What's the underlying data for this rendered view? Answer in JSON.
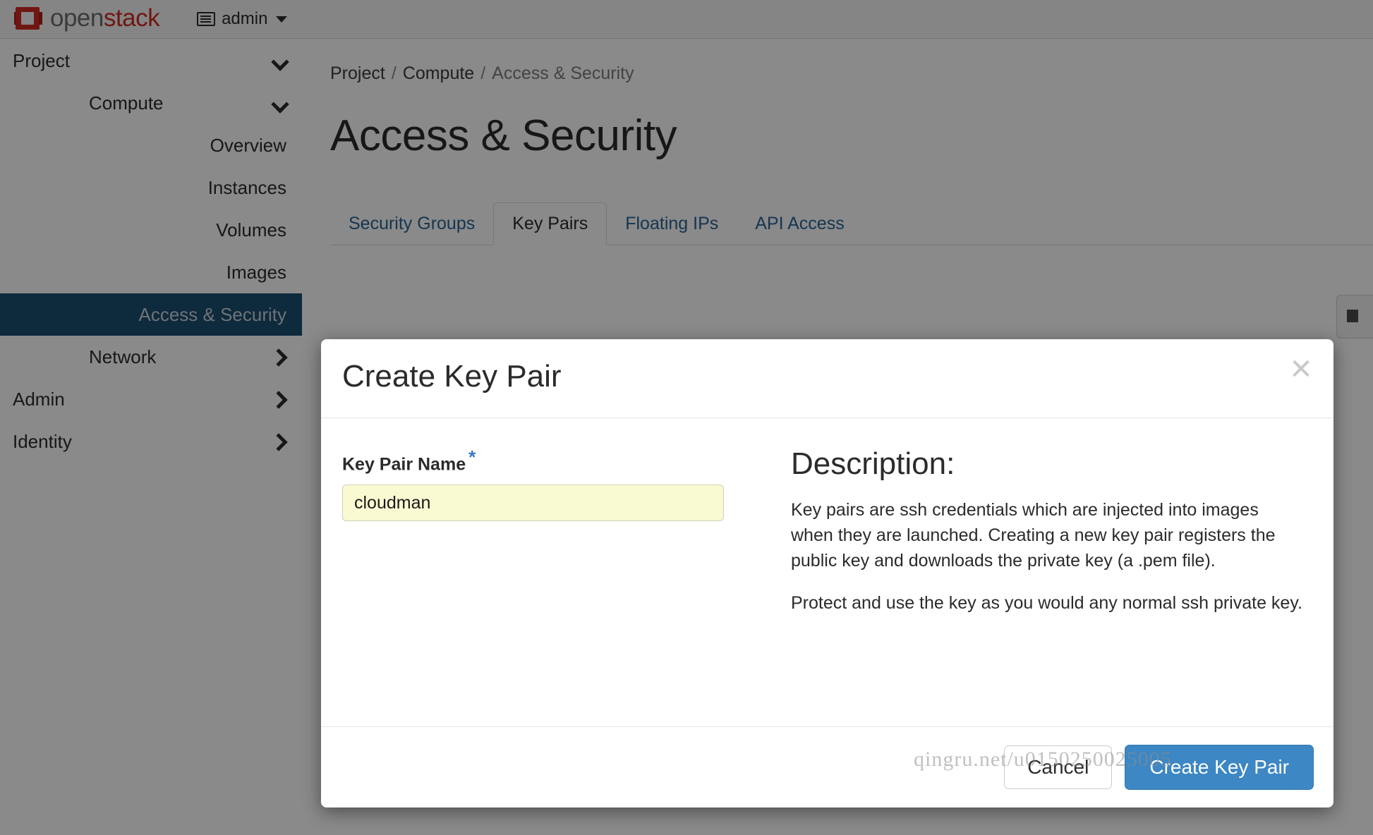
{
  "topbar": {
    "brand_open": "open",
    "brand_stack": "stack",
    "user_label": "admin",
    "list_icon": "list-icon",
    "caret_icon": "caret-down-icon"
  },
  "sidebar": {
    "items": [
      {
        "label": "Project",
        "level": 0,
        "chevron": "down",
        "active": false
      },
      {
        "label": "Compute",
        "level": 1,
        "chevron": "down",
        "active": false
      },
      {
        "label": "Overview",
        "level": 2,
        "chevron": "none",
        "active": false
      },
      {
        "label": "Instances",
        "level": 2,
        "chevron": "none",
        "active": false
      },
      {
        "label": "Volumes",
        "level": 2,
        "chevron": "none",
        "active": false
      },
      {
        "label": "Images",
        "level": 2,
        "chevron": "none",
        "active": false
      },
      {
        "label": "Access & Security",
        "level": 2,
        "chevron": "none",
        "active": true
      },
      {
        "label": "Network",
        "level": 1,
        "chevron": "right",
        "active": false
      },
      {
        "label": "Admin",
        "level": 0,
        "chevron": "right",
        "active": false
      },
      {
        "label": "Identity",
        "level": 0,
        "chevron": "right",
        "active": false
      }
    ]
  },
  "breadcrumb": {
    "items": [
      "Project",
      "Compute",
      "Access & Security"
    ],
    "separator": "/"
  },
  "page": {
    "title": "Access & Security"
  },
  "tabs": [
    {
      "label": "Security Groups",
      "active": false
    },
    {
      "label": "Key Pairs",
      "active": true
    },
    {
      "label": "Floating IPs",
      "active": false
    },
    {
      "label": "API Access",
      "active": false
    }
  ],
  "modal": {
    "title": "Create Key Pair",
    "close_icon": "close-icon",
    "form": {
      "field_label": "Key Pair Name",
      "required_marker": "*",
      "value": "cloudman",
      "placeholder": ""
    },
    "description": {
      "heading": "Description:",
      "paragraphs": [
        "Key pairs are ssh credentials which are injected into images when they are launched. Creating a new key pair registers the public key and downloads the private key (a .pem file).",
        "Protect and use the key as you would any normal ssh private key."
      ]
    },
    "footer": {
      "cancel_label": "Cancel",
      "submit_label": "Create Key Pair"
    }
  },
  "watermark": {
    "text": "qingru.net/u0150250025005"
  },
  "colors": {
    "brand_red": "#cf2c24",
    "sidebar_active": "#1b4f72",
    "link_blue": "#2a6496",
    "primary_button": "#3c87c4",
    "input_autofill": "#fafad2",
    "required_star": "#3a76c4"
  }
}
